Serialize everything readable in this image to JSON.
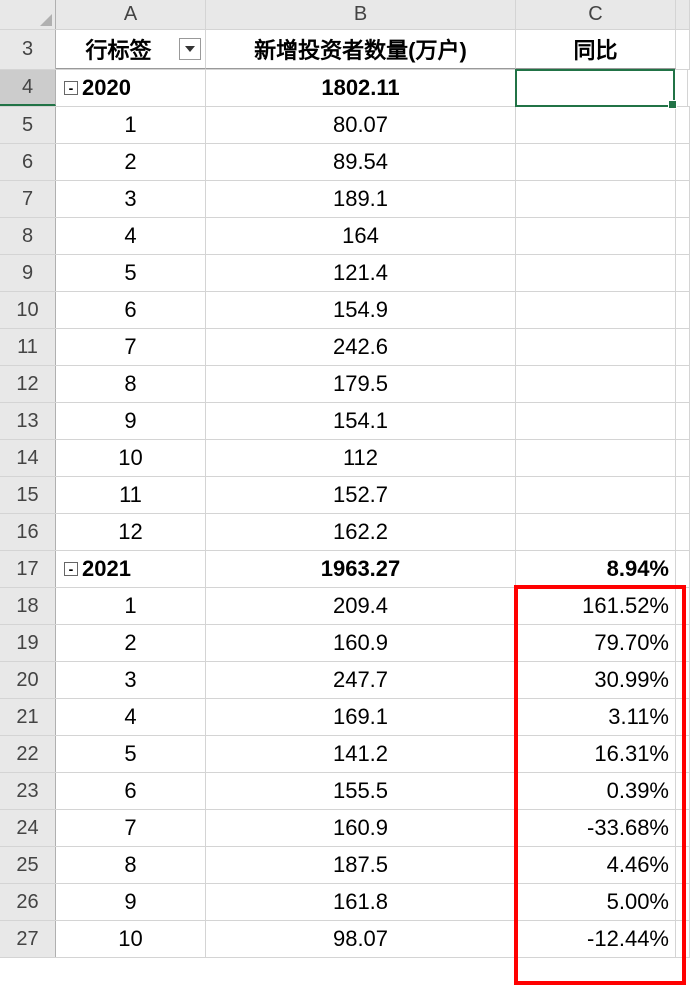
{
  "column_labels": {
    "a": "A",
    "b": "B",
    "c": "C"
  },
  "headers": {
    "row_label": "行标签",
    "value": "新增投资者数量(万户)",
    "yoy": "同比"
  },
  "collapse_symbol": "-",
  "rows": [
    {
      "num": "3",
      "type": "header"
    },
    {
      "num": "4",
      "type": "year",
      "a": "2020",
      "b": "1802.11",
      "c": "",
      "selected": true
    },
    {
      "num": "5",
      "type": "month",
      "a": "1",
      "b": "80.07",
      "c": ""
    },
    {
      "num": "6",
      "type": "month",
      "a": "2",
      "b": "89.54",
      "c": ""
    },
    {
      "num": "7",
      "type": "month",
      "a": "3",
      "b": "189.1",
      "c": ""
    },
    {
      "num": "8",
      "type": "month",
      "a": "4",
      "b": "164",
      "c": ""
    },
    {
      "num": "9",
      "type": "month",
      "a": "5",
      "b": "121.4",
      "c": ""
    },
    {
      "num": "10",
      "type": "month",
      "a": "6",
      "b": "154.9",
      "c": ""
    },
    {
      "num": "11",
      "type": "month",
      "a": "7",
      "b": "242.6",
      "c": ""
    },
    {
      "num": "12",
      "type": "month",
      "a": "8",
      "b": "179.5",
      "c": ""
    },
    {
      "num": "13",
      "type": "month",
      "a": "9",
      "b": "154.1",
      "c": ""
    },
    {
      "num": "14",
      "type": "month",
      "a": "10",
      "b": "112",
      "c": ""
    },
    {
      "num": "15",
      "type": "month",
      "a": "11",
      "b": "152.7",
      "c": ""
    },
    {
      "num": "16",
      "type": "month",
      "a": "12",
      "b": "162.2",
      "c": ""
    },
    {
      "num": "17",
      "type": "year",
      "a": "2021",
      "b": "1963.27",
      "c": "8.94%"
    },
    {
      "num": "18",
      "type": "month",
      "a": "1",
      "b": "209.4",
      "c": "161.52%"
    },
    {
      "num": "19",
      "type": "month",
      "a": "2",
      "b": "160.9",
      "c": "79.70%"
    },
    {
      "num": "20",
      "type": "month",
      "a": "3",
      "b": "247.7",
      "c": "30.99%"
    },
    {
      "num": "21",
      "type": "month",
      "a": "4",
      "b": "169.1",
      "c": "3.11%"
    },
    {
      "num": "22",
      "type": "month",
      "a": "5",
      "b": "141.2",
      "c": "16.31%"
    },
    {
      "num": "23",
      "type": "month",
      "a": "6",
      "b": "155.5",
      "c": "0.39%"
    },
    {
      "num": "24",
      "type": "month",
      "a": "7",
      "b": "160.9",
      "c": "-33.68%"
    },
    {
      "num": "25",
      "type": "month",
      "a": "8",
      "b": "187.5",
      "c": "4.46%"
    },
    {
      "num": "26",
      "type": "month",
      "a": "9",
      "b": "161.8",
      "c": "5.00%"
    },
    {
      "num": "27",
      "type": "month",
      "a": "10",
      "b": "98.07",
      "c": "-12.44%"
    }
  ]
}
